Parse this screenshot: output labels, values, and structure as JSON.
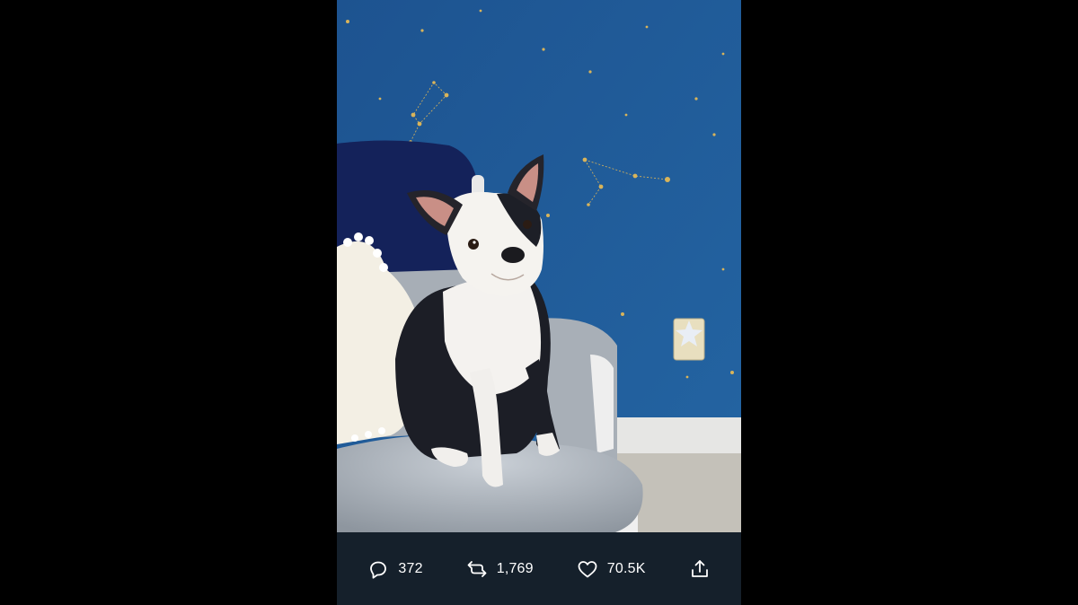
{
  "actions": {
    "reply": {
      "icon": "reply-icon",
      "count": "372"
    },
    "retweet": {
      "icon": "retweet-icon",
      "count": "1,769"
    },
    "like": {
      "icon": "heart-icon",
      "count": "70.5K"
    },
    "share": {
      "icon": "share-icon"
    }
  },
  "colors": {
    "backdrop": "#000000",
    "action_bar": "#15202b",
    "wall": "#1f5a96",
    "text": "#ffffff"
  },
  "media": {
    "icon": "photo-boston-terrier-on-glider-chair"
  }
}
